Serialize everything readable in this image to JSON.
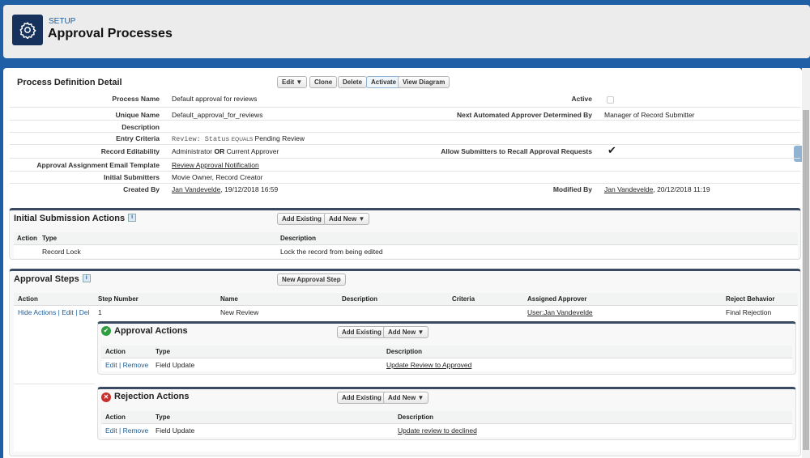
{
  "header": {
    "setup": "SETUP",
    "title": "Approval Processes"
  },
  "detail": {
    "title": "Process Definition Detail",
    "buttons": {
      "edit": "Edit",
      "clone": "Clone",
      "delete": "Delete",
      "activate": "Activate",
      "view_diagram": "View Diagram"
    },
    "fields": {
      "process_name_label": "Process Name",
      "process_name": "Default approval for reviews",
      "active_label": "Active",
      "active": false,
      "unique_name_label": "Unique Name",
      "unique_name": "Default_approval_for_reviews",
      "next_approver_label": "Next Automated Approver Determined By",
      "next_approver": "Manager of Record Submitter",
      "description_label": "Description",
      "entry_criteria_label": "Entry Criteria",
      "entry_criteria_field": "Review: Status",
      "entry_criteria_op": "EQUALS",
      "entry_criteria_value": "Pending Review",
      "record_editability_label": "Record Editability",
      "editability_a": "Administrator",
      "editability_or": "OR",
      "editability_b": "Current Approver",
      "allow_recall_label": "Allow Submitters to Recall Approval Requests",
      "allow_recall": true,
      "email_template_label": "Approval Assignment Email Template",
      "email_template": "Review Approval Notification",
      "initial_submitters_label": "Initial Submitters",
      "initial_submitters": "Movie Owner, Record Creator",
      "created_by_label": "Created By",
      "created_by_user": "Jan Vandevelde",
      "created_by_date": ", 19/12/2018 16:59",
      "modified_by_label": "Modified By",
      "modified_by_user": "Jan Vandevelde",
      "modified_by_date": ", 20/12/2018 11:19"
    }
  },
  "initial_submission": {
    "title": "Initial Submission Actions",
    "add_existing": "Add Existing",
    "add_new": "Add New",
    "columns": [
      "Action",
      "Type",
      "Description"
    ],
    "rows": [
      {
        "type": "Record Lock",
        "description": "Lock the record from being edited"
      }
    ]
  },
  "approval_steps": {
    "title": "Approval Steps",
    "new_step": "New Approval Step",
    "columns": [
      "Action",
      "Step Number",
      "Name",
      "Description",
      "Criteria",
      "Assigned Approver",
      "Reject Behavior"
    ],
    "row": {
      "hide_actions": "Hide Actions",
      "edit": "Edit",
      "del": "Del",
      "step": "1",
      "name": "New Review",
      "approver": "User:Jan Vandevelde",
      "reject": "Final Rejection"
    },
    "approval_actions": {
      "title": "Approval Actions",
      "add_existing": "Add Existing",
      "add_new": "Add New",
      "columns": [
        "Action",
        "Type",
        "Description"
      ],
      "row": {
        "edit": "Edit",
        "remove": "Remove",
        "type": "Field Update",
        "description": "Update Review to Approved"
      }
    },
    "rejection_actions": {
      "title": "Rejection Actions",
      "add_existing": "Add Existing",
      "add_new": "Add New",
      "columns": [
        "Action",
        "Type",
        "Description"
      ],
      "row": {
        "edit": "Edit",
        "remove": "Remove",
        "type": "Field Update",
        "description": "Update review to declined"
      }
    }
  },
  "colors": {
    "brand": "#16325c",
    "link": "#1a5d9c"
  }
}
